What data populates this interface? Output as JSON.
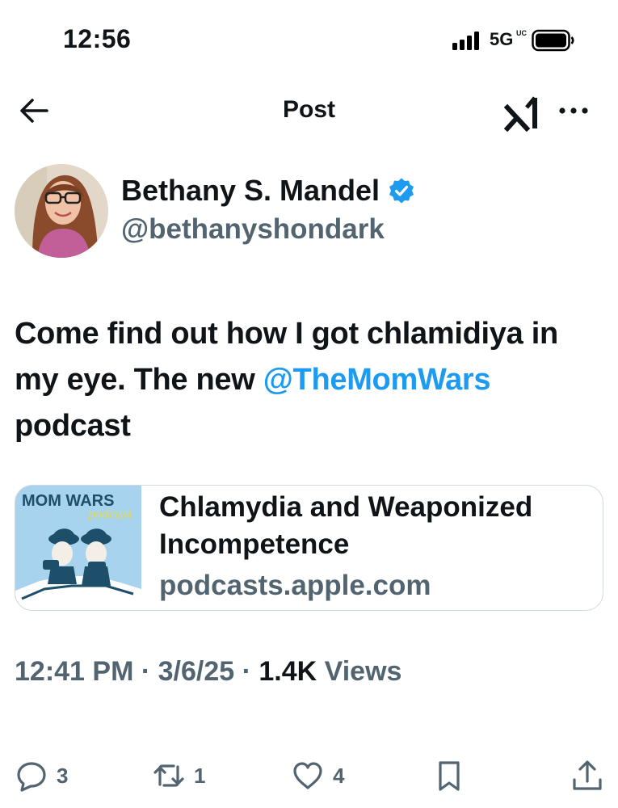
{
  "status_bar": {
    "time": "12:56",
    "network": "5G",
    "network_sup": "UC"
  },
  "nav": {
    "title": "Post"
  },
  "author": {
    "name": "Bethany S. Mandel",
    "handle": "@bethanyshondark",
    "verified": true
  },
  "tweet": {
    "text_before": "Come find out how I got chlamidiya in my eye. The new ",
    "mention": "@TheMomWars",
    "text_after": " podcast"
  },
  "link_card": {
    "thumbnail_logo": "MOM WARS",
    "thumbnail_sub": "podcast",
    "title": "Chlamydia and Weaponized Incompetence",
    "domain": "podcasts.apple.com"
  },
  "meta": {
    "time": "12:41 PM",
    "separator": " · ",
    "date": "3/6/25",
    "views_count": "1.4K",
    "views_label": "Views"
  },
  "actions": {
    "replies": "3",
    "reposts": "1",
    "likes": "4"
  },
  "colors": {
    "accent": "#1d9bf0",
    "text": "#0f1419",
    "secondary": "#536471",
    "border": "#cfd9de"
  }
}
